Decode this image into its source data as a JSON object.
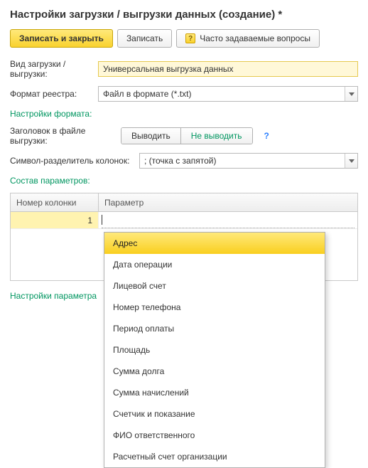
{
  "title": "Настройки загрузки / выгрузки данных (создание) *",
  "toolbar": {
    "save_close": "Записать и закрыть",
    "save": "Записать",
    "faq": "Часто задаваемые вопросы"
  },
  "form": {
    "type_label": "Вид загрузки / выгрузки:",
    "type_value": "Универсальная выгрузка данных",
    "format_label": "Формат реестра:",
    "format_value": "Файл в формате (*.txt)"
  },
  "format_section": {
    "title": "Настройки формата:",
    "header_label": "Заголовок в файле выгрузки:",
    "seg_show": "Выводить",
    "seg_hide": "Не выводить",
    "help": "?",
    "delim_label": "Символ-разделитель колонок:",
    "delim_value": ";   (точка с запятой)"
  },
  "params_section": {
    "title": "Состав параметров:",
    "col1": "Номер колонки",
    "col2": "Параметр",
    "row1_num": "1"
  },
  "param_settings_title": "Настройки параметра",
  "dropdown": {
    "items": [
      "Адрес",
      "Дата операции",
      "Лицевой счет",
      "Номер телефона",
      "Период оплаты",
      "Площадь",
      "Сумма долга",
      "Сумма начислений",
      "Счетчик и показание",
      "ФИО ответственного",
      "Расчетный счет организации"
    ],
    "selected_index": 0
  }
}
